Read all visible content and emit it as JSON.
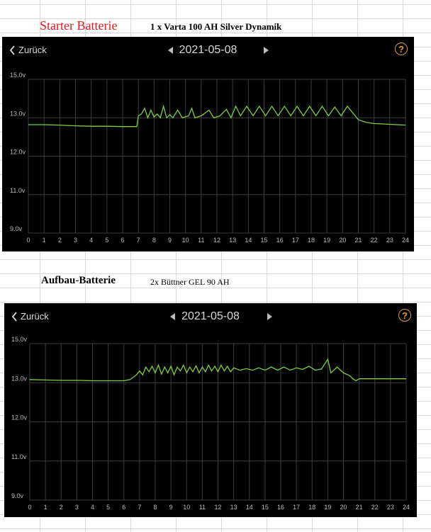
{
  "sheet": {
    "starter_title": "Starter Batterie",
    "starter_subtitle": "1 x Varta 100 AH Silver Dynamik",
    "aufbau_title": "Aufbau-Batterie",
    "aufbau_subtitle": "2x Büttner GEL 90 AH"
  },
  "panels": [
    {
      "back_label": "Zurück",
      "date": "2021-05-08",
      "help_symbol": "?"
    },
    {
      "back_label": "Zurück",
      "date": "2021-05-08",
      "help_symbol": "?"
    }
  ],
  "colors": {
    "line": "#7fcf3c",
    "grid": "#3c3c3c",
    "axis_text": "#bbbbbb",
    "background": "#000000",
    "accent": "#e0a030"
  },
  "icons": {
    "back": "chevron-left-icon",
    "prev": "caret-left-icon",
    "next": "caret-right-icon",
    "help": "question-circle-icon"
  },
  "chart_data": [
    {
      "type": "line",
      "title": "",
      "xlabel": "",
      "ylabel": "",
      "x_ticks": [
        0,
        1,
        2,
        3,
        4,
        5,
        6,
        7,
        8,
        9,
        10,
        11,
        12,
        13,
        14,
        15,
        16,
        17,
        18,
        19,
        20,
        21,
        22,
        23,
        24
      ],
      "y_ticks": [
        "15.0v",
        "13.0v",
        "12.0v",
        "11.0v",
        "9.0v"
      ],
      "y_tick_values": [
        14,
        13,
        12,
        11,
        10
      ],
      "xlim": [
        0,
        24
      ],
      "ylim": [
        10,
        14
      ],
      "grid": true,
      "series": [
        {
          "values": [
            [
              0,
              12.82
            ],
            [
              1,
              12.82
            ],
            [
              2,
              12.81
            ],
            [
              3,
              12.79
            ],
            [
              4,
              12.78
            ],
            [
              5,
              12.78
            ],
            [
              6,
              12.77
            ],
            [
              6.9,
              12.77
            ],
            [
              7.0,
              13.05
            ],
            [
              7.2,
              13.1
            ],
            [
              7.4,
              13.25
            ],
            [
              7.6,
              13.0
            ],
            [
              7.8,
              13.2
            ],
            [
              8.0,
              13.02
            ],
            [
              8.2,
              13.1
            ],
            [
              8.4,
              13.0
            ],
            [
              8.6,
              13.3
            ],
            [
              8.8,
              13.0
            ],
            [
              9.0,
              13.08
            ],
            [
              9.2,
              13.0
            ],
            [
              9.5,
              13.2
            ],
            [
              9.8,
              13.0
            ],
            [
              10.2,
              13.05
            ],
            [
              10.4,
              13.25
            ],
            [
              10.6,
              13.0
            ],
            [
              11.0,
              13.05
            ],
            [
              11.5,
              13.2
            ],
            [
              11.8,
              13.0
            ],
            [
              12.2,
              13.05
            ],
            [
              12.6,
              13.22
            ],
            [
              12.9,
              13.0
            ],
            [
              13.2,
              13.3
            ],
            [
              13.5,
              13.05
            ],
            [
              13.9,
              13.3
            ],
            [
              14.3,
              13.05
            ],
            [
              14.7,
              13.3
            ],
            [
              15.1,
              13.05
            ],
            [
              15.5,
              13.3
            ],
            [
              15.9,
              13.05
            ],
            [
              16.3,
              13.3
            ],
            [
              16.7,
              13.05
            ],
            [
              17.1,
              13.3
            ],
            [
              17.5,
              13.05
            ],
            [
              17.9,
              13.3
            ],
            [
              18.3,
              13.05
            ],
            [
              18.7,
              13.3
            ],
            [
              19.1,
              13.05
            ],
            [
              19.5,
              13.28
            ],
            [
              19.9,
              13.05
            ],
            [
              20.3,
              13.3
            ],
            [
              20.7,
              13.1
            ],
            [
              21.0,
              12.95
            ],
            [
              21.5,
              12.88
            ],
            [
              22,
              12.85
            ],
            [
              23,
              12.83
            ],
            [
              24,
              12.81
            ]
          ]
        }
      ]
    },
    {
      "type": "line",
      "title": "",
      "xlabel": "",
      "ylabel": "",
      "x_ticks": [
        0,
        1,
        2,
        3,
        4,
        5,
        6,
        7,
        8,
        9,
        10,
        11,
        12,
        13,
        14,
        15,
        16,
        17,
        18,
        19,
        20,
        21,
        22,
        23,
        24
      ],
      "y_ticks": [
        "15.0v",
        "13.0v",
        "12.0v",
        "11.0v",
        "9.0v"
      ],
      "y_tick_values": [
        14,
        13,
        12,
        11,
        10
      ],
      "xlim": [
        0,
        24
      ],
      "ylim": [
        10,
        14
      ],
      "grid": true,
      "series": [
        {
          "values": [
            [
              0,
              13.08
            ],
            [
              1,
              13.07
            ],
            [
              2,
              13.06
            ],
            [
              3,
              13.06
            ],
            [
              4,
              13.05
            ],
            [
              5,
              13.05
            ],
            [
              6,
              13.05
            ],
            [
              6.4,
              13.08
            ],
            [
              6.8,
              13.2
            ],
            [
              7.0,
              13.3
            ],
            [
              7.2,
              13.2
            ],
            [
              7.4,
              13.4
            ],
            [
              7.6,
              13.28
            ],
            [
              7.8,
              13.42
            ],
            [
              8.0,
              13.25
            ],
            [
              8.2,
              13.45
            ],
            [
              8.4,
              13.22
            ],
            [
              8.6,
              13.4
            ],
            [
              8.8,
              13.25
            ],
            [
              9.0,
              13.42
            ],
            [
              9.2,
              13.2
            ],
            [
              9.4,
              13.4
            ],
            [
              9.6,
              13.3
            ],
            [
              9.8,
              13.45
            ],
            [
              10.0,
              13.25
            ],
            [
              10.2,
              13.4
            ],
            [
              10.4,
              13.28
            ],
            [
              10.6,
              13.43
            ],
            [
              10.8,
              13.25
            ],
            [
              11.0,
              13.4
            ],
            [
              11.2,
              13.28
            ],
            [
              11.4,
              13.45
            ],
            [
              11.6,
              13.3
            ],
            [
              11.8,
              13.42
            ],
            [
              12.0,
              13.28
            ],
            [
              12.2,
              13.45
            ],
            [
              12.4,
              13.3
            ],
            [
              12.6,
              13.42
            ],
            [
              12.8,
              13.28
            ],
            [
              13.0,
              13.38
            ],
            [
              13.4,
              13.32
            ],
            [
              13.8,
              13.36
            ],
            [
              14.2,
              13.32
            ],
            [
              14.6,
              13.38
            ],
            [
              15.0,
              13.32
            ],
            [
              15.4,
              13.4
            ],
            [
              15.8,
              13.32
            ],
            [
              16.2,
              13.4
            ],
            [
              16.6,
              13.32
            ],
            [
              17.0,
              13.38
            ],
            [
              17.4,
              13.34
            ],
            [
              17.8,
              13.42
            ],
            [
              18.2,
              13.32
            ],
            [
              18.6,
              13.35
            ],
            [
              19.0,
              13.6
            ],
            [
              19.2,
              13.25
            ],
            [
              19.6,
              13.4
            ],
            [
              20.0,
              13.25
            ],
            [
              20.4,
              13.18
            ],
            [
              20.6,
              13.1
            ],
            [
              20.8,
              13.05
            ],
            [
              21.0,
              13.1
            ],
            [
              22,
              13.1
            ],
            [
              23,
              13.1
            ],
            [
              24,
              13.1
            ]
          ]
        }
      ]
    }
  ]
}
